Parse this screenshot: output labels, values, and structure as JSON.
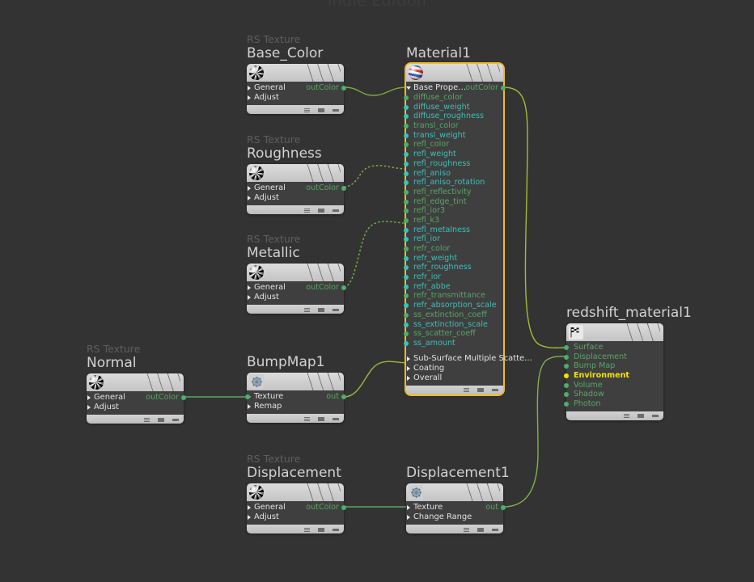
{
  "app": {
    "watermark": "Indie Edition",
    "canvas_bg": "#333333"
  },
  "colors": {
    "selection": "#f0bc1e",
    "wire": "#6faa5a",
    "wire_solid": "#58a862",
    "port_green": "#4caf6a",
    "port_teal": "#35c4bb",
    "port_yellow": "#f3e300",
    "label_green": "#59a567",
    "label_teal": "#3fbfb6",
    "node_bg": "#3f3f3f",
    "title": "#d2d2d2",
    "type_label": "#5e5e5e"
  },
  "nodes": [
    {
      "id": "base_color",
      "type_label": "RS Texture",
      "title": "Base_Color",
      "icon": "checkered-ball-icon",
      "rows": [
        {
          "label": "General",
          "kind": "group"
        },
        {
          "label": "Adjust",
          "kind": "group"
        }
      ],
      "output": "outColor"
    },
    {
      "id": "roughness",
      "type_label": "RS Texture",
      "title": "Roughness",
      "icon": "checkered-ball-icon",
      "rows": [
        {
          "label": "General",
          "kind": "group"
        },
        {
          "label": "Adjust",
          "kind": "group"
        }
      ],
      "output": "outColor"
    },
    {
      "id": "metallic",
      "type_label": "RS Texture",
      "title": "Metallic",
      "icon": "checkered-ball-icon",
      "rows": [
        {
          "label": "General",
          "kind": "group"
        },
        {
          "label": "Adjust",
          "kind": "group"
        }
      ],
      "output": "outColor"
    },
    {
      "id": "normal",
      "type_label": "RS Texture",
      "title": "Normal",
      "icon": "checkered-ball-icon",
      "rows": [
        {
          "label": "General",
          "kind": "group"
        },
        {
          "label": "Adjust",
          "kind": "group"
        }
      ],
      "output": "outColor"
    },
    {
      "id": "displacement",
      "type_label": "RS Texture",
      "title": "Displacement",
      "icon": "checkered-ball-icon",
      "rows": [
        {
          "label": "General",
          "kind": "group"
        },
        {
          "label": "Adjust",
          "kind": "group"
        }
      ],
      "output": "outColor"
    },
    {
      "id": "bumpmap1",
      "type_label": "",
      "title": "BumpMap1",
      "icon": "gear-icon",
      "rows": [
        {
          "label": "Texture",
          "kind": "group"
        },
        {
          "label": "Remap",
          "kind": "group"
        }
      ],
      "output": "out"
    },
    {
      "id": "displacement1",
      "type_label": "",
      "title": "Displacement1",
      "icon": "gear-icon",
      "rows": [
        {
          "label": "Texture",
          "kind": "group"
        },
        {
          "label": "Change Range",
          "kind": "group"
        }
      ],
      "output": "out"
    },
    {
      "id": "material1",
      "type_label": "",
      "title": "Material1",
      "icon": "material-ball-icon",
      "selected": true,
      "output": "outColor",
      "rows": [
        {
          "label": "Base Prope…",
          "kind": "group_open"
        },
        {
          "label": "diffuse_color",
          "kind": "param",
          "color": "green"
        },
        {
          "label": "diffuse_weight",
          "kind": "param",
          "color": "teal"
        },
        {
          "label": "diffuse_roughness",
          "kind": "param",
          "color": "teal"
        },
        {
          "label": "transl_color",
          "kind": "param",
          "color": "green"
        },
        {
          "label": "transl_weight",
          "kind": "param",
          "color": "teal"
        },
        {
          "label": "refl_color",
          "kind": "param",
          "color": "green"
        },
        {
          "label": "refl_weight",
          "kind": "param",
          "color": "teal"
        },
        {
          "label": "refl_roughness",
          "kind": "param",
          "color": "teal"
        },
        {
          "label": "refl_aniso",
          "kind": "param",
          "color": "teal"
        },
        {
          "label": "refl_aniso_rotation",
          "kind": "param",
          "color": "teal"
        },
        {
          "label": "refl_reflectivity",
          "kind": "param",
          "color": "green"
        },
        {
          "label": "refl_edge_tint",
          "kind": "param",
          "color": "green"
        },
        {
          "label": "refl_ior3",
          "kind": "param",
          "color": "green"
        },
        {
          "label": "refl_k3",
          "kind": "param",
          "color": "green"
        },
        {
          "label": "refl_metalness",
          "kind": "param",
          "color": "teal"
        },
        {
          "label": "refl_ior",
          "kind": "param",
          "color": "teal"
        },
        {
          "label": "refr_color",
          "kind": "param",
          "color": "green"
        },
        {
          "label": "refr_weight",
          "kind": "param",
          "color": "teal"
        },
        {
          "label": "refr_roughness",
          "kind": "param",
          "color": "teal"
        },
        {
          "label": "refr_ior",
          "kind": "param",
          "color": "teal"
        },
        {
          "label": "refr_abbe",
          "kind": "param",
          "color": "teal"
        },
        {
          "label": "refr_transmittance",
          "kind": "param",
          "color": "green"
        },
        {
          "label": "refr_absorption_scale",
          "kind": "param",
          "color": "teal"
        },
        {
          "label": "ss_extinction_coeff",
          "kind": "param",
          "color": "green"
        },
        {
          "label": "ss_extinction_scale",
          "kind": "param",
          "color": "teal"
        },
        {
          "label": "ss_scatter_coeff",
          "kind": "param",
          "color": "green"
        },
        {
          "label": "ss_amount",
          "kind": "param",
          "color": "teal"
        },
        {
          "label": "",
          "kind": "spacer"
        },
        {
          "label": "Sub-Surface Multiple Scatte…",
          "kind": "group"
        },
        {
          "label": "Coating",
          "kind": "group"
        },
        {
          "label": "Overall",
          "kind": "group"
        }
      ]
    },
    {
      "id": "redshift_material1",
      "type_label": "",
      "title": "redshift_material1",
      "icon": "checkered-flag-icon",
      "output": "",
      "rows": [
        {
          "label": "Surface",
          "kind": "param",
          "color": "green"
        },
        {
          "label": "Displacement",
          "kind": "param",
          "color": "green"
        },
        {
          "label": "Bump Map",
          "kind": "param",
          "color": "green"
        },
        {
          "label": "Environment",
          "kind": "param",
          "color": "yellow"
        },
        {
          "label": "Volume",
          "kind": "param",
          "color": "green"
        },
        {
          "label": "Shadow",
          "kind": "param",
          "color": "green"
        },
        {
          "label": "Photon",
          "kind": "param",
          "color": "green"
        }
      ]
    }
  ],
  "connections": [
    {
      "from": "Base_Color.outColor",
      "to": "Material1.Base Prope…",
      "style": "solid"
    },
    {
      "from": "Roughness.outColor",
      "to": "Material1.refl_roughness",
      "style": "dashed"
    },
    {
      "from": "Metallic.outColor",
      "to": "Material1.refl_metalness",
      "style": "dashed"
    },
    {
      "from": "Normal.outColor",
      "to": "BumpMap1.Texture",
      "style": "solid"
    },
    {
      "from": "BumpMap1.out",
      "to": "Material1.Overall",
      "style": "solid"
    },
    {
      "from": "Displacement.outColor",
      "to": "Displacement1.Texture",
      "style": "solid"
    },
    {
      "from": "Displacement1.out",
      "to": "redshift_material1.Displacement",
      "style": "solid"
    },
    {
      "from": "Material1.outColor",
      "to": "redshift_material1.Surface",
      "style": "solid"
    }
  ]
}
